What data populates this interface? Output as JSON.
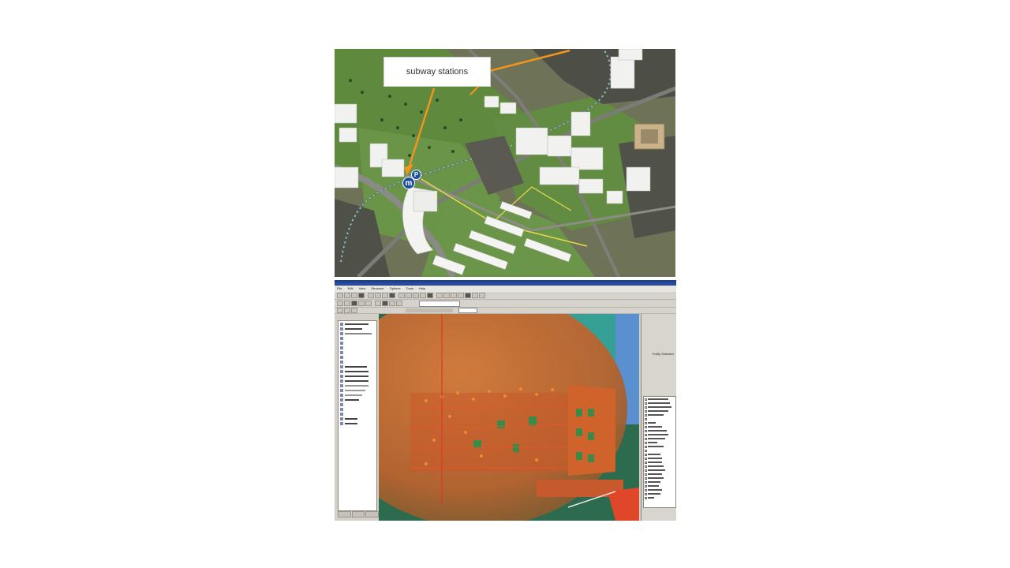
{
  "map": {
    "callout_label": "subway stations",
    "metro_letter_m": "m",
    "metro_letter_p": "P"
  },
  "app": {
    "menu_items": [
      "File",
      "Edit",
      "View",
      "Structure",
      "Options",
      "Tools",
      "Help"
    ],
    "properties_label": "Entity Selected"
  }
}
